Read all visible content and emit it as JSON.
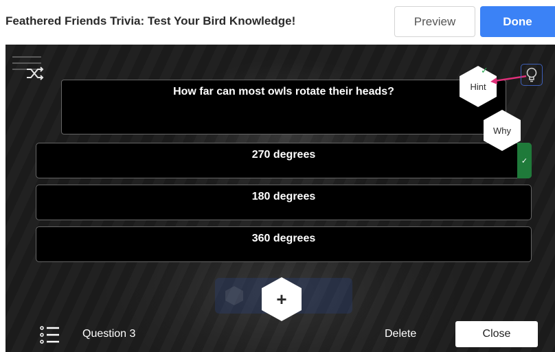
{
  "header": {
    "title": "Feathered Friends Trivia: Test Your Bird Knowledge!",
    "preview_label": "Preview",
    "done_label": "Done"
  },
  "editor": {
    "question": "How far can most owls rotate their heads?",
    "answers": [
      {
        "text": "270 degrees",
        "correct": true
      },
      {
        "text": "180 degrees",
        "correct": false
      },
      {
        "text": "360 degrees",
        "correct": false
      }
    ],
    "correct_mark": "✓",
    "hint_label": "Hint",
    "hint_check": "✓",
    "why_label": "Why",
    "add_label": "+"
  },
  "footer": {
    "question_label": "Question 3",
    "delete_label": "Delete",
    "close_label": "Close"
  },
  "icons": {
    "menu": "menu-lines-icon",
    "shuffle": "shuffle-icon",
    "lightbulb": "lightbulb-icon",
    "list": "list-icon"
  },
  "colors": {
    "accent": "#3b82f6",
    "correct": "#1f7a3a",
    "arrow": "#e0307a",
    "stage": "#1c1c1c"
  }
}
